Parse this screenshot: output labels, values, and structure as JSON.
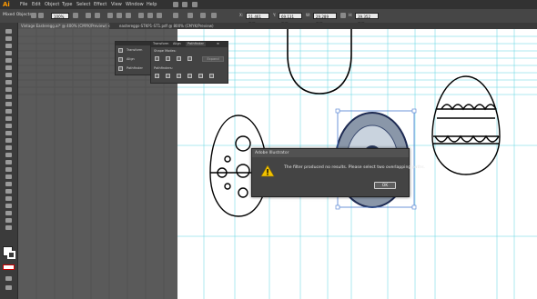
{
  "app": {
    "logo": "Ai"
  },
  "menu": [
    "File",
    "Edit",
    "Object",
    "Type",
    "Select",
    "Effect",
    "View",
    "Window",
    "Help"
  ],
  "control_bar": {
    "selection_label": "Mixed Objects",
    "zoom": "100%",
    "x_value": "51.461 mm",
    "y_value": "69.131 mm",
    "w_value": "29.289 mm",
    "h_value": "39.352 mm"
  },
  "tabs": [
    {
      "label": "Vintage Easteregg.ai* @ 400% (CMYK/Preview)"
    },
    {
      "label": "eastereggs-STKP1-ST1.pdf @ 800% (CMYK/Preview)"
    }
  ],
  "panel_transform": {
    "items": [
      "Transform",
      "Align",
      "Pathfinder"
    ]
  },
  "panel_pathfinder": {
    "tabs": [
      "Transform",
      "Align",
      "Pathfinder"
    ],
    "shape_modes_label": "Shape Modes:",
    "expand_label": "Expand",
    "pathfinders_label": "Pathfinders:"
  },
  "dialog": {
    "title": "Adobe Illustrator",
    "message": "The filter produced no results. Please select two overlapping paths.",
    "ok_label": "OK"
  },
  "colors": {
    "menubar": "#323232",
    "panel": "#434343",
    "artboard": "#ffffff",
    "guide": "#5fd3e0",
    "selection": "#4a7bd0",
    "warning": "#f2c200"
  },
  "icons": [
    "warning-icon",
    "close-icon",
    "selection-tool-icon",
    "pen-tool-icon",
    "type-tool-icon",
    "zoom-tool-icon"
  ]
}
